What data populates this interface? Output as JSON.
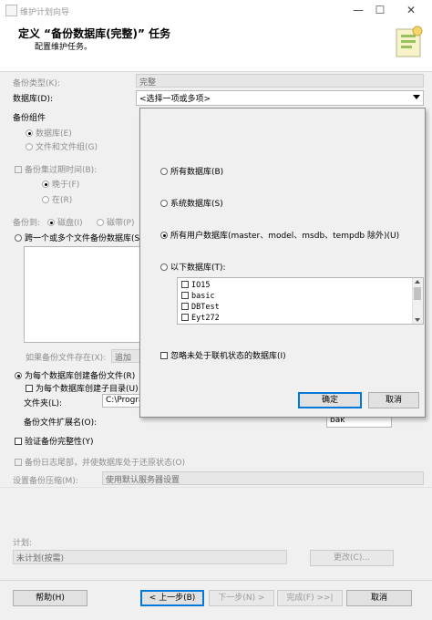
{
  "window": {
    "title": "维护计划向导",
    "minimize": "—",
    "maximize": "☐",
    "close": "✕"
  },
  "header": {
    "title": "定义 “备份数据库(完整)” 任务",
    "subtitle": "配置维护任务。"
  },
  "form": {
    "backup_type_label": "备份类型(K):",
    "backup_type_value": "完整",
    "database_label": "数据库(D):",
    "database_value": "<选择一项或多项>",
    "backup_component_label": "备份组件",
    "radio_database": "数据库(E)",
    "radio_files": "文件和文件组(G)",
    "expire_label": "备份集过期时间(B):",
    "radio_after": "晚于(F)",
    "radio_on": "在(R)",
    "backup_to_label": "备份到:",
    "radio_disk": "磁盘(I)",
    "radio_tape": "磁带(P)",
    "radio_span_files": "跨一个或多个文件备份数据库(S",
    "if_exists_label": "如果备份文件存在(X):",
    "if_exists_value": "追加",
    "radio_create_per_db": "为每个数据库创建备份文件(R)",
    "check_subdir": "为每个数据库创建子目录(U)",
    "folder_label": "文件夹(L):",
    "folder_value": "C:\\Progra",
    "ext_label": "备份文件扩展名(O):",
    "ext_value": "bak",
    "check_verify": "验证备份完整性(Y)",
    "check_taillog": "备份日志尾部，并使数据库处于还原状态(O)",
    "compression_label": "设置备份压缩(M):",
    "compression_value": "使用默认服务器设置",
    "schedule_label": "计划:",
    "schedule_value": "未计划(按需)",
    "change_button": "更改(C)..."
  },
  "popup": {
    "option_all": "所有数据库(B)",
    "option_system": "系统数据库(S)",
    "option_user": "所有用户数据库(master、model、msdb、tempdb 除外)(U)",
    "option_these": "以下数据库(T):",
    "databases": [
      "IO15",
      "basic",
      "DBTest",
      "Eyt272"
    ],
    "ignore_offline": "忽略未处于联机状态的数据库(I)",
    "ok": "确定",
    "cancel": "取消",
    "selected_option": "option_user"
  },
  "footer": {
    "help": "帮助(H)",
    "back": "< 上一步(B)",
    "next": "下一步(N) >",
    "finish": "完成(F) >>|",
    "cancel": "取消"
  }
}
